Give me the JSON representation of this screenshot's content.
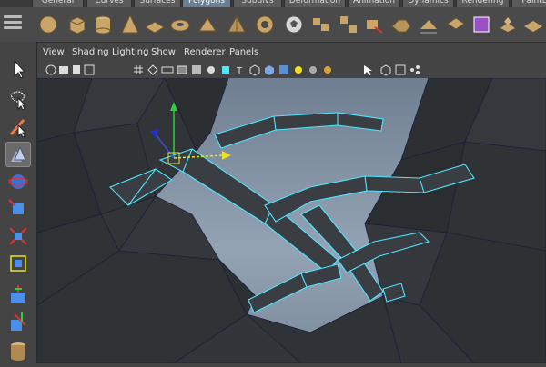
{
  "shelf_tabs": [
    {
      "label": "General",
      "active": false
    },
    {
      "label": "Curves",
      "active": false
    },
    {
      "label": "Surfaces",
      "active": false
    },
    {
      "label": "Polygons",
      "active": true
    },
    {
      "label": "Subdivs",
      "active": false
    },
    {
      "label": "Deformation",
      "active": false
    },
    {
      "label": "Animation",
      "active": false
    },
    {
      "label": "Dynamics",
      "active": false
    },
    {
      "label": "Rendering",
      "active": false
    },
    {
      "label": "PaintEf",
      "active": false
    }
  ],
  "panel_menu": [
    "View",
    "Shading",
    "Lighting",
    "Show",
    "Renderer",
    "Panels"
  ],
  "colors": {
    "ui_dark": "#444444",
    "active_tab": "#6a7f94",
    "wire_highlight": "#4ee6ff",
    "mesh_face": "#3a3d42",
    "viewport_bg": "#8595a6"
  },
  "shelf_icons": [
    "sphere-icon",
    "cube-icon",
    "cylinder-icon",
    "cone-icon",
    "plane-icon",
    "torus-icon",
    "prism-icon",
    "pyramid-icon",
    "pipe-icon",
    "soccer-ball-icon",
    "combine-icon",
    "separate-icon",
    "extract-icon",
    "smooth-icon",
    "reduce-icon",
    "cleanup-icon",
    "booleans-icon",
    "extrude-icon",
    "bridge-icon",
    "split-icon",
    "append-icon",
    "textured-cube-icon",
    "fill-hole-icon",
    "paint-select-icon",
    "bevel-icon",
    "wedge-icon",
    "poke-icon",
    "merge-icon"
  ],
  "tool_icons": [
    "select-tool-icon",
    "lasso-tool-icon",
    "paint-select-tool-icon",
    "move-tool-icon",
    "rotate-tool-icon",
    "scale-tool-icon",
    "universal-manipulator-icon",
    "soft-mod-icon",
    "show-manipulator-icon",
    "last-tool-icon",
    "cylinder-object-icon",
    "layout-icon"
  ]
}
